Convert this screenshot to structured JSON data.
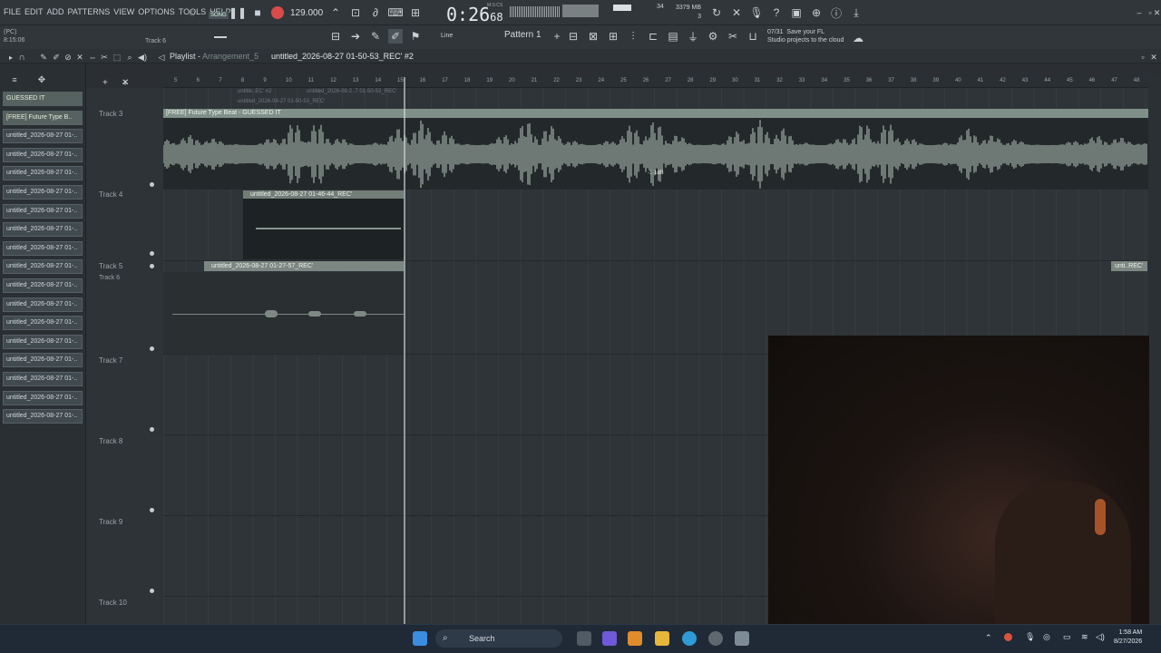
{
  "menu": [
    "FILE",
    "EDIT",
    "ADD",
    "PATTERNS",
    "VIEW",
    "OPTIONS",
    "TOOLS",
    "HELP"
  ],
  "transport": {
    "mode": "SONG",
    "tempo": "129.000",
    "time_main": "0:26",
    "time_sub": "68",
    "time_unit": "M:S:CS"
  },
  "monitor": {
    "cpu": "34",
    "memory": "3379 MB",
    "voices": "3"
  },
  "hint": {
    "pc": "(PC)",
    "time": "8:15:06",
    "track": "Track 6"
  },
  "toolbar2": {
    "snap": "Line",
    "pattern": "Pattern 1"
  },
  "cloud": {
    "counter": "07/31",
    "line1": "Save your FL",
    "line2": "Studio projects to the cloud"
  },
  "playlist": {
    "title": "Playlist",
    "arrangement": "Arrangement_5",
    "active_clip": "untitled_2026-08-27 01-50-53_REC' #2"
  },
  "ruler": [
    "5",
    "6",
    "7",
    "8",
    "9",
    "10",
    "11",
    "12",
    "13",
    "14",
    "15",
    "16",
    "17",
    "18",
    "19",
    "20",
    "21",
    "22",
    "23",
    "24",
    "25",
    "26",
    "27",
    "28",
    "29",
    "30",
    "31",
    "32",
    "33",
    "34",
    "35",
    "36",
    "37",
    "38",
    "39",
    "40",
    "41",
    "42",
    "43",
    "44",
    "45",
    "46",
    "47",
    "48"
  ],
  "picker": [
    "GUESSED IT",
    "[FREE] Future Type B..",
    "untitled_2026-08-27 01-..",
    "untitled_2026-08-27 01-..",
    "untitled_2026-08-27 01-..",
    "untitled_2026-08-27 01-..",
    "untitled_2026-08-27 01-..",
    "untitled_2026-08-27 01-..",
    "untitled_2026-08-27 01-..",
    "untitled_2026-08-27 01-..",
    "untitled_2026-08-27 01-..",
    "untitled_2026-08-27 01-..",
    "untitled_2026-08-27 01-..",
    "untitled_2026-08-27 01-..",
    "untitled_2026-08-27 01-..",
    "untitled_2026-08-27 01-..",
    "untitled_2026-08-27 01-..",
    "untitled_2026-08-27 01-.."
  ],
  "tracks": {
    "t3": "Track 3",
    "t4": "Track 4",
    "t5": "Track 5",
    "t6": "Track 6",
    "t7": "Track 7",
    "t8": "Track 8",
    "t9": "Track 9",
    "t10": "Track 10"
  },
  "clips": {
    "track3": "[FREE] Future Type Beat - GUESSED IT",
    "track3_gain": "-1.1dB",
    "track4": "untitled_2026-08-27 01-46-44_REC'",
    "track5": "untitled_2026-08-27 01-27-57_REC'",
    "track5b": "unti..REC'",
    "top1": "untitle..EC' #2",
    "top2": "untitled_2026-08-2..7 01-50-53_REC'",
    "top3": "untitled_2026-08-27 01-50-53_REC'"
  },
  "taskbar": {
    "search": "Search",
    "time": "1:58 AM",
    "date": "8/27/2026"
  },
  "colors": {
    "record": "#d94a4a",
    "clip_header": "#7f9088",
    "background": "#2b2f33",
    "taskbar": "#1f2a36"
  }
}
